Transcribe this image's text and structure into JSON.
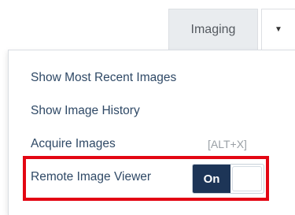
{
  "header": {
    "imaging_label": "Imaging",
    "dropdown_icon": "caret-down-icon"
  },
  "menu": {
    "items": [
      {
        "label": "Show Most Recent Images"
      },
      {
        "label": "Show Image History"
      },
      {
        "label": "Acquire Images",
        "shortcut": "[ALT+X]"
      },
      {
        "label": "Remote Image Viewer"
      }
    ],
    "remote_viewer_toggle": {
      "state_label": "On",
      "checked": true
    }
  },
  "colors": {
    "highlight": "#e30613",
    "toggle_on_bg": "#1d3557",
    "menu_text": "#2f4966"
  }
}
